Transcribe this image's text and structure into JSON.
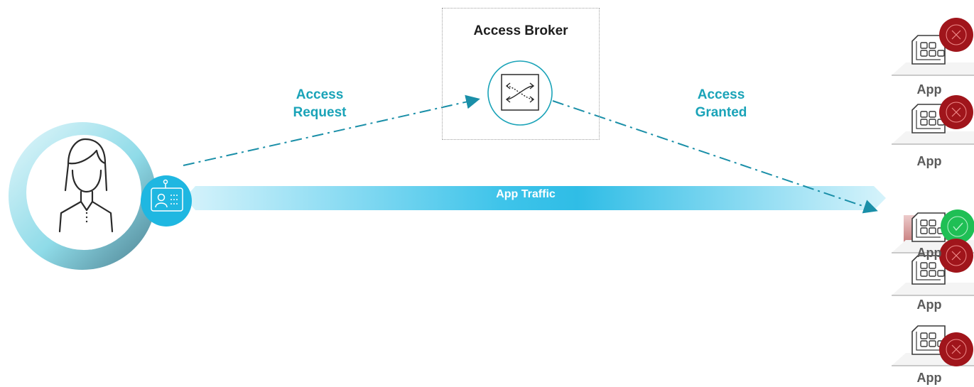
{
  "broker": {
    "title": "Access Broker",
    "icon": "shuffle-icon"
  },
  "flow": {
    "request_line1": "Access",
    "request_line2": "Request",
    "granted_line1": "Access",
    "granted_line2": "Granted",
    "traffic": "App Traffic"
  },
  "user": {
    "icon": "user-avatar-icon",
    "badge_icon": "id-badge-icon"
  },
  "apps": [
    {
      "label": "App",
      "status": "denied"
    },
    {
      "label": "App",
      "status": "denied"
    },
    {
      "label": "App",
      "status": "granted"
    },
    {
      "label": "App",
      "status": "denied"
    },
    {
      "label": "App",
      "status": "denied"
    }
  ],
  "colors": {
    "teal": "#1aa3b8",
    "deny": "#a0151b",
    "allow": "#1fbf55",
    "traffic_light": "#d8f4fb",
    "traffic_dark": "#2fc0e6"
  }
}
